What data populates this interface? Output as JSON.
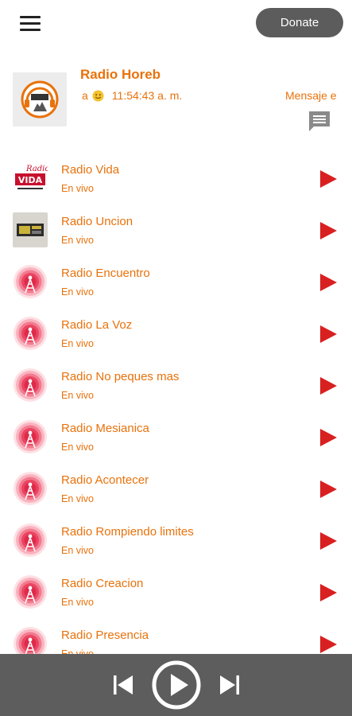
{
  "header": {
    "menu_icon": "hamburger-menu-icon",
    "donate_label": "Donate"
  },
  "now_playing": {
    "title": "Radio Horeb",
    "prefix": "a",
    "emoji": "smile-emoji",
    "time": "11:54:43 a. m.",
    "message": "Mensaje e",
    "chat_icon": "chat-message-icon"
  },
  "stations": [
    {
      "name": "Radio Vida",
      "status": "En vivo",
      "logo": "radio-vida-logo"
    },
    {
      "name": "Radio Uncion",
      "status": "En vivo",
      "logo": "radio-uncion-logo"
    },
    {
      "name": "Radio Encuentro",
      "status": "En vivo",
      "logo": "radio-tower-icon"
    },
    {
      "name": "Radio La Voz",
      "status": "En vivo",
      "logo": "radio-tower-icon"
    },
    {
      "name": "Radio No peques mas",
      "status": "En vivo",
      "logo": "radio-tower-icon"
    },
    {
      "name": "Radio Mesianica",
      "status": "En vivo",
      "logo": "radio-tower-icon"
    },
    {
      "name": "Radio Acontecer",
      "status": "En vivo",
      "logo": "radio-tower-icon"
    },
    {
      "name": "Radio Rompiendo limites",
      "status": "En vivo",
      "logo": "radio-tower-icon"
    },
    {
      "name": "Radio Creacion",
      "status": "En vivo",
      "logo": "radio-tower-icon"
    },
    {
      "name": "Radio Presencia",
      "status": "En vivo",
      "logo": "radio-tower-icon"
    }
  ],
  "player": {
    "prev_icon": "skip-previous-icon",
    "play_icon": "play-circle-icon",
    "next_icon": "skip-next-icon"
  },
  "colors": {
    "accent": "#e8720c",
    "play_red": "#d92020",
    "player_bar": "#5d5d5d",
    "donate_bg": "#5c5c5c"
  }
}
